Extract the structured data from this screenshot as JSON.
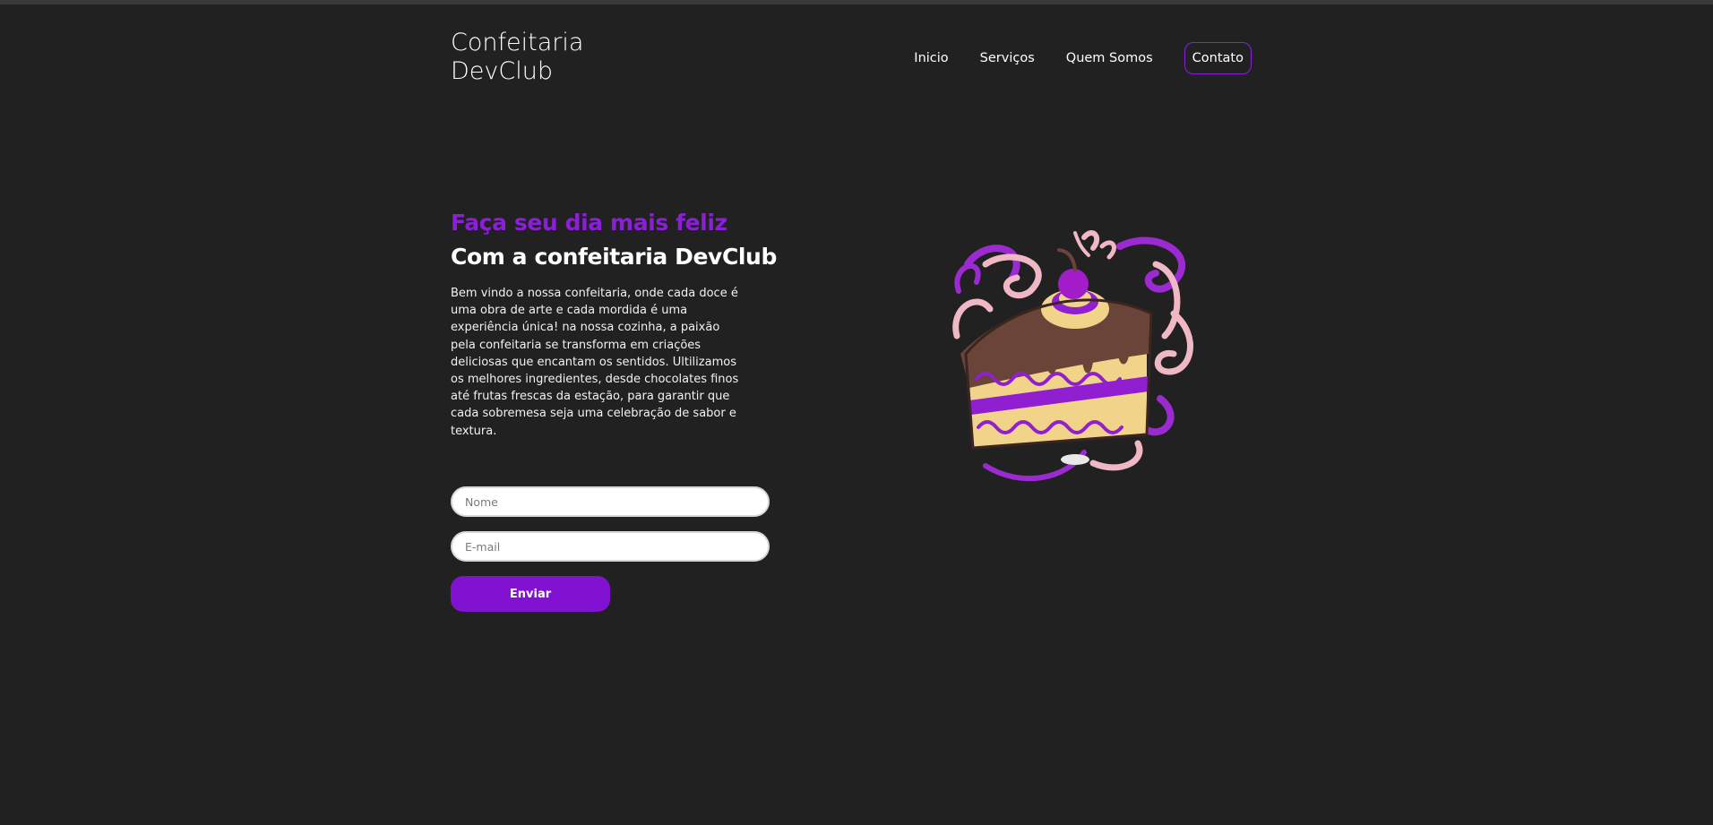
{
  "header": {
    "logo_line1": "Confeitaria",
    "logo_line2": "DevClub",
    "nav": [
      {
        "label": "Inicio"
      },
      {
        "label": "Serviços"
      },
      {
        "label": "Quem Somos"
      },
      {
        "label": "Contato"
      }
    ]
  },
  "hero": {
    "headline_purple": "Faça seu dia mais feliz",
    "headline_white": "Com a confeitaria DevClub",
    "description": "Bem vindo a nossa confeitaria, onde cada doce é uma obra de arte e cada mordida é uma experiência única! na nossa cozinha, a paixão pela confeitaria se transforma em criações deliciosas que encantam os sentidos. Ultilizamos os melhores ingredientes, desde chocolates finos até frutas frescas da estação, para garantir que cada sobremesa seja uma celebração de sabor e textura."
  },
  "form": {
    "name_placeholder": "Nome",
    "email_placeholder": "E-mail",
    "submit_label": "Enviar"
  },
  "colors": {
    "background": "#212121",
    "accent": "#8a1fd6",
    "button": "#8212d1"
  },
  "illustration": {
    "icon": "cake-slice-icon"
  }
}
